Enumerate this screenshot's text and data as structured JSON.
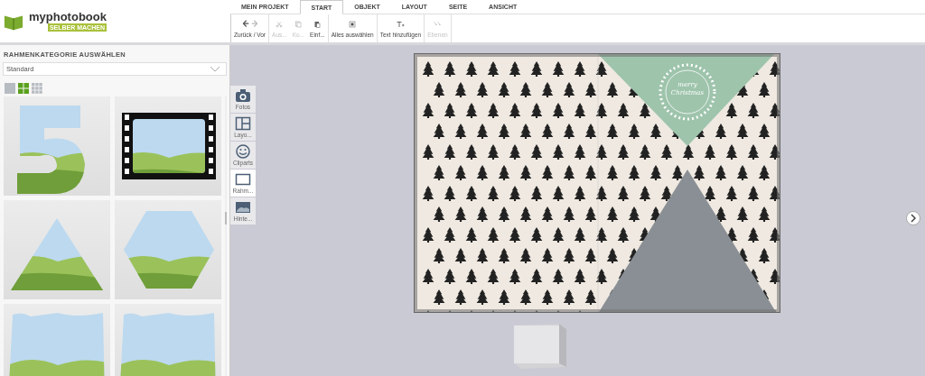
{
  "logo": {
    "name": "myphotobook",
    "tagline": "SELBER MACHEN"
  },
  "tabs": [
    {
      "label": "MEIN PROJEKT",
      "selected": false
    },
    {
      "label": "START",
      "selected": true
    },
    {
      "label": "OBJEKT",
      "selected": false
    },
    {
      "label": "LAYOUT",
      "selected": false
    },
    {
      "label": "SEITE",
      "selected": false
    },
    {
      "label": "ANSICHT",
      "selected": false
    }
  ],
  "toolbar": [
    {
      "kind": "undo-redo",
      "label": "Zurück / Vor",
      "disabled": false
    },
    {
      "kind": "cut",
      "label": "Aus...",
      "disabled": true
    },
    {
      "kind": "copy",
      "label": "Ko...",
      "disabled": true
    },
    {
      "kind": "paste",
      "label": "Einf...",
      "disabled": false
    },
    {
      "kind": "select-all",
      "label": "Alles auswählen",
      "disabled": false
    },
    {
      "kind": "add-text",
      "label": "Text hinzufügen",
      "disabled": false
    },
    {
      "kind": "layers",
      "label": "Ebenen",
      "disabled": true
    }
  ],
  "panel": {
    "title": "RAHMENKATEGORIE AUSWÄHLEN",
    "category": "Standard",
    "view_sizes": [
      {
        "selected": false
      },
      {
        "selected": true
      },
      {
        "selected": false
      }
    ]
  },
  "side_tabs": [
    {
      "kind": "camera",
      "label": "Fotos",
      "selected": false
    },
    {
      "kind": "layout",
      "label": "Layo...",
      "selected": false
    },
    {
      "kind": "smiley",
      "label": "Cliparts",
      "selected": false
    },
    {
      "kind": "frame",
      "label": "Rahm...",
      "selected": true
    },
    {
      "kind": "background",
      "label": "Hinte...",
      "selected": false
    }
  ],
  "card": {
    "greeting": "merry Christmas"
  }
}
